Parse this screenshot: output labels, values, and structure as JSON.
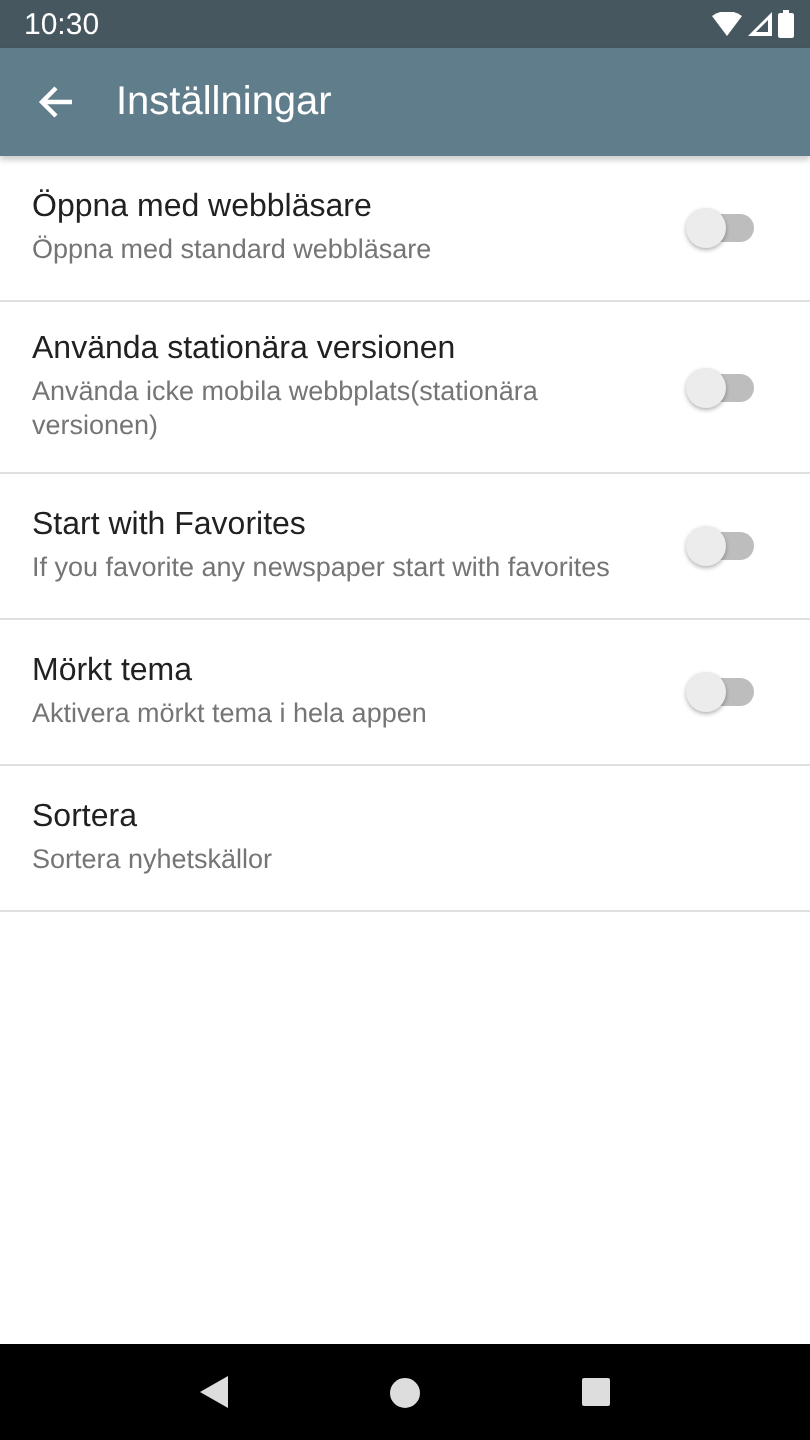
{
  "status_bar": {
    "time": "10:30"
  },
  "app_bar": {
    "title": "Inställningar"
  },
  "settings": [
    {
      "kind": "toggle",
      "title": "Öppna med webbläsare",
      "subtitle": "Öppna med standard webbläsare",
      "on": false
    },
    {
      "kind": "toggle",
      "title": "Använda stationära versionen",
      "subtitle": "Använda icke mobila webbplats(stationära versionen)",
      "on": false
    },
    {
      "kind": "toggle",
      "title": "Start with Favorites",
      "subtitle": "If you favorite any newspaper start with favorites",
      "on": false
    },
    {
      "kind": "toggle",
      "title": "Mörkt tema",
      "subtitle": "Aktivera mörkt tema i hela appen",
      "on": false
    },
    {
      "kind": "link",
      "title": "Sortera",
      "subtitle": "Sortera nyhetskällor"
    }
  ]
}
